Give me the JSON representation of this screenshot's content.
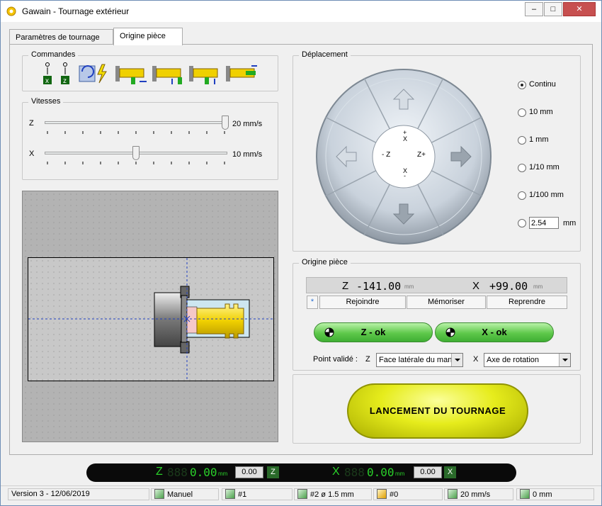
{
  "window": {
    "title": "Gawain  -  Tournage extérieur",
    "min": "–",
    "max": "□",
    "close": "✕"
  },
  "tabs": [
    {
      "label": "Paramètres de tournage"
    },
    {
      "label": "Origine pièce"
    }
  ],
  "commandes": {
    "title": "Commandes",
    "buttons": [
      "x-home",
      "z-home",
      "spindle",
      "tool-z-left",
      "tool-x-up",
      "tool-x-up-2",
      "tool-z-right"
    ]
  },
  "vitesses": {
    "title": "Vitesses",
    "z": {
      "label": "Z",
      "value": "20 mm/s",
      "level": 1.0
    },
    "x": {
      "label": "X",
      "value": "10 mm/s",
      "level": 0.5
    }
  },
  "deplacement": {
    "title": "Déplacement",
    "center": {
      "x_plus": "+",
      "x_top": "X",
      "z_minus": "- Z",
      "z_plus": "Z+",
      "x_bottom": "X",
      "x_minus": "-"
    },
    "modes": [
      {
        "label": "Continu",
        "selected": true
      },
      {
        "label": "10 mm",
        "selected": false
      },
      {
        "label": "1 mm",
        "selected": false
      },
      {
        "label": "1/10 mm",
        "selected": false
      },
      {
        "label": "1/100 mm",
        "selected": false
      }
    ],
    "custom": {
      "value": "2.54",
      "unit": "mm"
    }
  },
  "origine": {
    "title": "Origine pièce",
    "z": {
      "axis": "Z",
      "value": "-141.00",
      "unit": "mm"
    },
    "x": {
      "axis": "X",
      "value": "+99.00",
      "unit": "mm"
    },
    "star": "*",
    "rejoindre": "Rejoindre",
    "memoriser": "Mémoriser",
    "reprendre": "Reprendre",
    "z_ok": "Z - ok",
    "x_ok": "X - ok",
    "point_label": "Point validé :",
    "pz_label": "Z",
    "pz_value": "Face latérale du mandrin",
    "px_label": "X",
    "px_value": "Axe de rotation"
  },
  "launch": "LANCEMENT  DU  TOURNAGE",
  "readout": {
    "z": {
      "axis": "Z",
      "ghost": "888",
      "value": "0.00",
      "unit": "mm",
      "box": "0.00",
      "btn": "Z"
    },
    "x": {
      "axis": "X",
      "ghost": "888",
      "value": "0.00",
      "unit": "mm",
      "box": "0.00",
      "btn": "X"
    }
  },
  "status": {
    "version": "Version 3 - 12/06/2019",
    "mode": "Manuel",
    "program": "#1",
    "tool": "#2  ø 1.5 mm",
    "origin": "#0",
    "speed": "20 mm/s",
    "depth": "0 mm"
  },
  "colors": {
    "accent_green": "#5ec84a",
    "launch_yellow": "#e6ec1c",
    "part_yellow": "#f0d000",
    "lcd_green": "#2ad02a"
  }
}
